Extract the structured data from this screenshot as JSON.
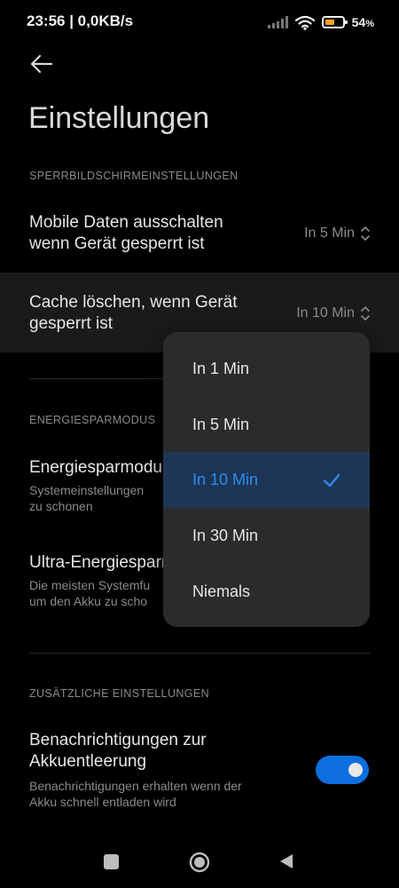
{
  "status_bar": {
    "time_speed": "23:56 | 0,0KB/s",
    "battery_percent": "54",
    "battery_suffix": "%",
    "battery_level": 0.54,
    "icons": [
      "signal-icon",
      "wifi-icon",
      "battery-icon"
    ]
  },
  "header": {
    "back_icon": "arrow-left-icon",
    "title": "Einstellungen"
  },
  "lock_section": {
    "label": "SPERRBILDSCHIRMEINSTELLUNGEN",
    "items": [
      {
        "label_line1": "Mobile Daten ausschalten",
        "label_line2": "wenn Gerät gesperrt ist",
        "value": "In 5 Min"
      },
      {
        "label_line1": "Cache löschen, wenn Gerät",
        "label_line2": "gesperrt ist",
        "value": "In 10 Min"
      }
    ]
  },
  "energy_section": {
    "label": "ENERGIESPARMODUS",
    "items": [
      {
        "title": "Energiesparmodus",
        "sub_line1": "Systemeinstellungen",
        "sub_line2": "zu schonen"
      },
      {
        "title": "Ultra-Energiesparmodus",
        "sub_line1": "Die meisten Systemfu",
        "sub_line2": "um den Akku zu scho"
      }
    ]
  },
  "extra_section": {
    "label": "ZUSÄTZLICHE EINSTELLUNGEN",
    "item": {
      "title_line1": "Benachrichtigungen zur",
      "title_line2": "Akkuentleerung",
      "sub_line1": "Benachrichtigungen erhalten wenn der",
      "sub_line2": "Akku schnell entladen wird",
      "toggle_on": true
    }
  },
  "dropdown": {
    "options": [
      "In 1 Min",
      "In 5 Min",
      "In 10 Min",
      "In 30 Min",
      "Niemals"
    ],
    "selected": "In 10 Min",
    "check_icon": "checkmark-icon"
  },
  "nav_bar": {
    "icons": [
      "recents-square-icon",
      "home-circle-icon",
      "back-triangle-icon"
    ]
  },
  "colors": {
    "accent": "#2b8cf0",
    "toggle": "#0d6ede",
    "selected_bg": "#1e3556",
    "battery": "#f5a623"
  }
}
